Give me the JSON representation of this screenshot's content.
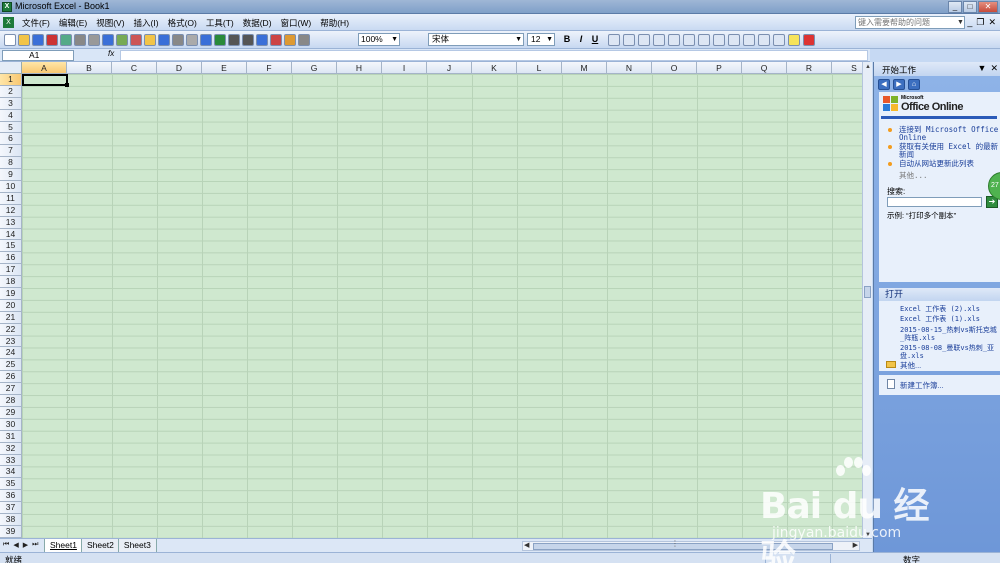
{
  "window": {
    "title": "Microsoft Excel - Book1",
    "app_icon": "excel-icon"
  },
  "menubar": {
    "items": [
      "文件(F)",
      "编辑(E)",
      "视图(V)",
      "插入(I)",
      "格式(O)",
      "工具(T)",
      "数据(D)",
      "窗口(W)",
      "帮助(H)"
    ],
    "help_placeholder": "键入需要帮助的问题"
  },
  "toolbar": {
    "zoom": "100%",
    "font": "宋体",
    "font_size": "12",
    "bold": "B",
    "italic": "I",
    "underline": "U"
  },
  "formula_bar": {
    "name_box": "A1",
    "fx": "fx"
  },
  "grid": {
    "columns": [
      "A",
      "B",
      "C",
      "D",
      "E",
      "F",
      "G",
      "H",
      "I",
      "J",
      "K",
      "L",
      "M",
      "N",
      "O",
      "P",
      "Q",
      "R",
      "S"
    ],
    "rows": [
      "1",
      "2",
      "3",
      "4",
      "5",
      "6",
      "7",
      "8",
      "9",
      "10",
      "11",
      "12",
      "13",
      "14",
      "15",
      "16",
      "17",
      "18",
      "19",
      "20",
      "21",
      "22",
      "23",
      "24",
      "25",
      "26",
      "27",
      "28",
      "29",
      "30",
      "31",
      "32",
      "33",
      "34",
      "35",
      "36",
      "37",
      "38",
      "39"
    ],
    "active_cell": "A1"
  },
  "sheets": [
    "Sheet1",
    "Sheet2",
    "Sheet3"
  ],
  "status": {
    "left": "就绪",
    "right": "数字"
  },
  "task_pane": {
    "title": "开始工作",
    "logo_small": "Microsoft",
    "logo": "Office Online",
    "links": [
      "连接到 Microsoft Office Online",
      "获取有关使用 Excel 的最新新闻",
      "自动从网站更新此列表"
    ],
    "other": "其他...",
    "search_label": "搜索:",
    "example": "示例: “打印多个副本”",
    "open_header": "打开",
    "files": [
      "Excel 工作表 (2).xls",
      "Excel 工作表 (1).xls",
      "2015-08-15_热刺vs斯托克城_阵瓶.xls",
      "2015-08-08_曼联vs热刺_亚盘.xls"
    ],
    "open_other": "其他...",
    "new_workbook": "新建工作簿..."
  },
  "badge": "27",
  "watermark": {
    "brand": "Bai du 经验",
    "url": "jingyan.baidu.com"
  },
  "colors": {
    "accent": "#2a5ab8",
    "grid_bg": "#cfe8cf",
    "active_header": "#f9c872"
  }
}
